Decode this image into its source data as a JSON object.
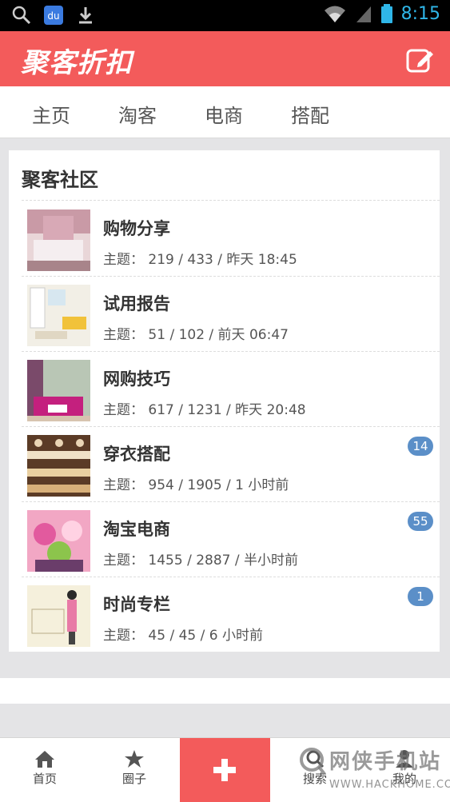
{
  "status_bar": {
    "time": "8:15"
  },
  "header": {
    "logo": "聚客折扣"
  },
  "tabs": [
    {
      "label": "主页"
    },
    {
      "label": "淘客"
    },
    {
      "label": "电商"
    },
    {
      "label": "搭配"
    }
  ],
  "community": {
    "title": "聚客社区",
    "items": [
      {
        "title": "购物分享",
        "meta": "主题： 219 / 433 / 昨天 18:45",
        "badge": ""
      },
      {
        "title": "试用报告",
        "meta": "主题： 51 / 102 / 前天 06:47",
        "badge": ""
      },
      {
        "title": "网购技巧",
        "meta": "主题： 617 / 1231 / 昨天 20:48",
        "badge": ""
      },
      {
        "title": "穿衣搭配",
        "meta": "主题： 954 / 1905 / 1 小时前",
        "badge": "14"
      },
      {
        "title": "淘宝电商",
        "meta": "主题： 1455 / 2887 / 半小时前",
        "badge": "55"
      },
      {
        "title": "时尚专栏",
        "meta": "主题： 45 / 45 / 6 小时前",
        "badge": "1"
      }
    ]
  },
  "bottom_nav": {
    "home": "首页",
    "circle": "圈子",
    "search": "搜索",
    "mine": "我的"
  },
  "watermark": {
    "text": "网侠手机站",
    "url": "WWW.HACKHOME.COM"
  },
  "colors": {
    "brand": "#f35b5b",
    "badge": "#5b8fc8"
  }
}
